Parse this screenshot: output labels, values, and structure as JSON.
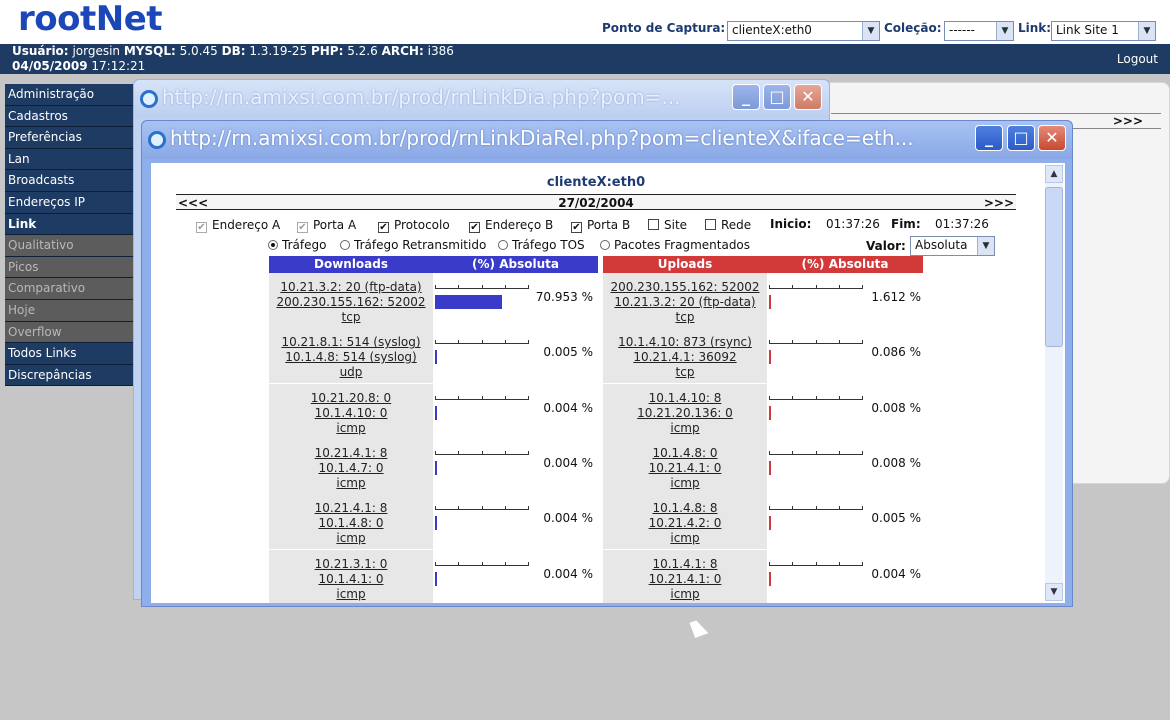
{
  "app": {
    "logo": "rootNet",
    "capture_label": "Ponto de Captura:",
    "capture_value": "clienteX:eth0",
    "collection_label": "Coleção:",
    "collection_value": "------",
    "link_label": "Link:",
    "link_value": "Link Site 1",
    "logout": "Logout"
  },
  "info": {
    "user_label": "Usuário:",
    "user": "jorgesin",
    "mysql_label": "MYSQL:",
    "mysql": "5.0.45",
    "db_label": "DB:",
    "db": "1.3.19-25",
    "php_label": "PHP:",
    "php": "5.2.6",
    "arch_label": "ARCH:",
    "arch": "i386",
    "date": "04/05/2009",
    "time": "17:12:21"
  },
  "menu": [
    {
      "label": "Administração",
      "state": "on"
    },
    {
      "label": "Cadastros",
      "state": "on"
    },
    {
      "label": "Preferências",
      "state": "on"
    },
    {
      "label": "Lan",
      "state": "on"
    },
    {
      "label": "Broadcasts",
      "state": "on"
    },
    {
      "label": "Endereços IP",
      "state": "on"
    },
    {
      "label": "Link",
      "state": "on"
    },
    {
      "label": "Qualitativo",
      "state": "off"
    },
    {
      "label": "Picos",
      "state": "off"
    },
    {
      "label": "Comparativo",
      "state": "off"
    },
    {
      "label": "Hoje",
      "state": "off"
    },
    {
      "label": "Overflow",
      "state": "off"
    },
    {
      "label": "Todos Links",
      "state": "on"
    },
    {
      "label": "Discrepâncias",
      "state": "on"
    }
  ],
  "bg_panel": {
    "nav": ">>>"
  },
  "window1": {
    "title": "http://rn.amixsi.com.br/prod/rnLinkDia.php?pom=..."
  },
  "window2": {
    "title": "http://rn.amixsi.com.br/prod/rnLinkDiaRel.php?pom=clienteX&iface=eth...",
    "header": "clienteX:eth0",
    "prev": "<<<",
    "next": ">>>",
    "date": "27/02/2004",
    "checks": [
      {
        "label": "Endereço A",
        "checked": true,
        "disabled": true
      },
      {
        "label": "Porta A",
        "checked": true,
        "disabled": true
      },
      {
        "label": "Protocolo",
        "checked": true,
        "disabled": false
      },
      {
        "label": "Endereço B",
        "checked": true,
        "disabled": false
      },
      {
        "label": "Porta B",
        "checked": true,
        "disabled": false
      },
      {
        "label": "Site",
        "checked": false,
        "disabled": false
      },
      {
        "label": "Rede",
        "checked": false,
        "disabled": false
      }
    ],
    "start_label": "Inicio:",
    "start": "01:37:26",
    "end_label": "Fim:",
    "end": "01:37:26",
    "radios": [
      {
        "label": "Tráfego",
        "checked": true
      },
      {
        "label": "Tráfego Retransmitido",
        "checked": false
      },
      {
        "label": "Tráfego TOS",
        "checked": false
      },
      {
        "label": "Pacotes Fragmentados",
        "checked": false
      }
    ],
    "valor_label": "Valor:",
    "valor": "Absoluta",
    "downloads_header": "Downloads",
    "uploads_header": "Uploads",
    "pct_header": "(%) Absoluta",
    "colors": {
      "download": "#3a3bc8",
      "upload": "#d23a3a"
    },
    "rows": [
      {
        "dl": [
          "10.21.3.2: 20 (ftp-data)",
          "200.230.155.162: 52002",
          "tcp"
        ],
        "dl_pct": "70.953 %",
        "dl_frac": 0.7095,
        "ul": [
          "200.230.155.162: 52002",
          "10.21.3.2: 20 (ftp-data)",
          "tcp"
        ],
        "ul_pct": "1.612 %",
        "ul_frac": 0.0161
      },
      {
        "dl": [
          "10.21.8.1: 514 (syslog)",
          "10.1.4.8: 514 (syslog)",
          "udp"
        ],
        "dl_pct": "0.005 %",
        "dl_frac": 5e-05,
        "ul": [
          "10.1.4.10: 873 (rsync)",
          "10.21.4.1: 36092",
          "tcp"
        ],
        "ul_pct": "0.086 %",
        "ul_frac": 0.00086
      },
      {
        "dl": [
          "10.21.20.8: 0",
          "10.1.4.10: 0",
          "icmp"
        ],
        "dl_pct": "0.004 %",
        "dl_frac": 4e-05,
        "ul": [
          "10.1.4.10: 8",
          "10.21.20.136: 0",
          "icmp"
        ],
        "ul_pct": "0.008 %",
        "ul_frac": 8e-05
      },
      {
        "dl": [
          "10.21.4.1: 8",
          "10.1.4.7: 0",
          "icmp"
        ],
        "dl_pct": "0.004 %",
        "dl_frac": 4e-05,
        "ul": [
          "10.1.4.8: 0",
          "10.21.4.1: 0",
          "icmp"
        ],
        "ul_pct": "0.008 %",
        "ul_frac": 8e-05
      },
      {
        "dl": [
          "10.21.4.1: 8",
          "10.1.4.8: 0",
          "icmp"
        ],
        "dl_pct": "0.004 %",
        "dl_frac": 4e-05,
        "ul": [
          "10.1.4.8: 8",
          "10.21.4.2: 0",
          "icmp"
        ],
        "ul_pct": "0.005 %",
        "ul_frac": 5e-05
      },
      {
        "dl": [
          "10.21.3.1: 0",
          "10.1.4.1: 0",
          "icmp"
        ],
        "dl_pct": "0.004 %",
        "dl_frac": 4e-05,
        "ul": [
          "10.1.4.1: 8",
          "10.21.4.1: 0",
          "icmp"
        ],
        "ul_pct": "0.004 %",
        "ul_frac": 4e-05
      }
    ]
  }
}
